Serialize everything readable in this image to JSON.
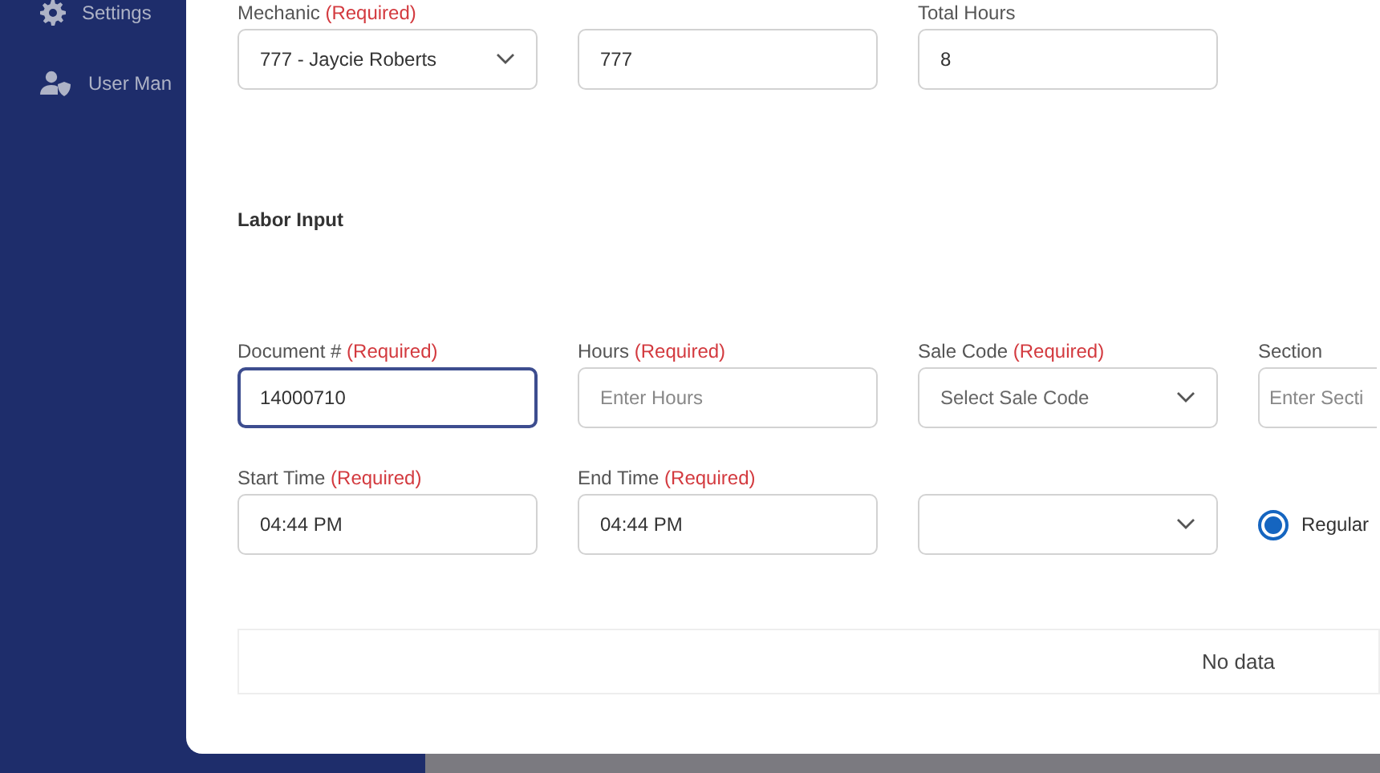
{
  "sidebar": {
    "items": [
      {
        "kind": "gear",
        "label": "Settings"
      },
      {
        "kind": "user-shield",
        "label": "User Man"
      }
    ]
  },
  "modal": {
    "top_fields": [
      {
        "kind": "select",
        "label": "Mechanic",
        "required_note": "(Required)",
        "value": "777 - Jaycie Roberts",
        "focused": false
      },
      {
        "kind": "input",
        "value": "777",
        "focused": false
      },
      {
        "kind": "input",
        "label": "Total Hours",
        "value": "8",
        "focused": false
      }
    ],
    "section_title": "Labor Input",
    "rows": [
      [
        {
          "kind": "input",
          "label": "Document #",
          "required_note": "(Required)",
          "value": "14000710",
          "focused": true
        },
        {
          "kind": "input",
          "label": "Hours",
          "required_note": "(Required)",
          "placeholder": "Enter Hours",
          "focused": false
        },
        {
          "kind": "select",
          "label": "Sale Code",
          "required_note": "(Required)",
          "placeholder": "Select Sale Code",
          "focused": false
        },
        {
          "kind": "input",
          "label": "Section",
          "placeholder": "Enter Secti",
          "focused": false
        }
      ],
      [
        {
          "kind": "input",
          "label": "Start Time",
          "required_note": "(Required)",
          "value": "04:44 PM",
          "focused": false
        },
        {
          "kind": "input",
          "label": "End Time",
          "required_note": "(Required)",
          "value": "04:44 PM",
          "focused": false
        },
        {
          "kind": "select",
          "focused": false
        },
        {
          "kind": "radio",
          "label": "Regular",
          "selected": true
        }
      ]
    ],
    "table": {
      "empty_text": "No data"
    }
  }
}
